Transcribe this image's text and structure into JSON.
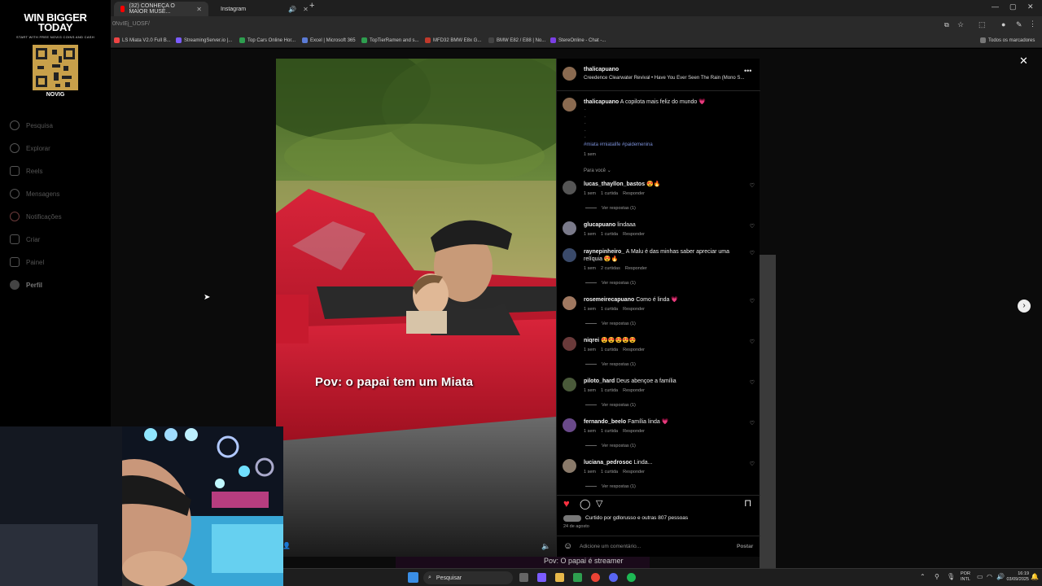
{
  "overlay": {
    "promo_title_line1": "WIN BIGGER",
    "promo_title_line2": "TODAY",
    "promo_subtitle": "START WITH FREE NOVIG COINS AND CASH",
    "promo_brand": "NOVIG"
  },
  "sidebar": {
    "items": [
      {
        "label": "Pesquisa",
        "icon": "search-icon"
      },
      {
        "label": "Explorar",
        "icon": "compass-icon"
      },
      {
        "label": "Reels",
        "icon": "reels-icon"
      },
      {
        "label": "Mensagens",
        "icon": "messenger-icon"
      },
      {
        "label": "Notificações",
        "icon": "heart-icon"
      },
      {
        "label": "Criar",
        "icon": "plus-icon"
      },
      {
        "label": "Painel",
        "icon": "dashboard-icon"
      },
      {
        "label": "Perfil",
        "icon": "profile-avatar-icon"
      }
    ]
  },
  "browser": {
    "tabs": [
      {
        "label": "(32) CONHEÇA O MAIOR MUSE...",
        "icon": "youtube-icon",
        "color": "#ff0000"
      },
      {
        "label": "Instagram",
        "icon": "instagram-icon",
        "color": "#e1306c"
      }
    ],
    "url": "0NvIEj_UOSF/",
    "bookmarks": [
      {
        "label": "LS Miata V2.0 Full B...",
        "color": "#e44"
      },
      {
        "label": "StreamingServer.io |...",
        "color": "#7b5cff"
      },
      {
        "label": "Top Cars Online Hor...",
        "color": "#2e9e4f"
      },
      {
        "label": "Excel | Microsoft 365",
        "color": "#5b7bd5"
      },
      {
        "label": "TopTierRamen and s...",
        "color": "#2e9e4f"
      },
      {
        "label": "MFD32 BMW E8x G...",
        "color": "#c0392b"
      },
      {
        "label": "BMW E82 / E88 | No...",
        "color": "#333"
      },
      {
        "label": "StereOnline - Chat -...",
        "color": "#7b3fe4"
      }
    ],
    "bookmarks_all": "Todos os marcadores"
  },
  "video": {
    "caption": "Pov: o papai tem um Miata"
  },
  "post": {
    "author": "thalicapuano",
    "audio": "Creedence Clearwater Revival • Have You Ever Seen The Rain (Mono S...",
    "caption_text": "A copilota mais feliz do mundo 💗",
    "dots": [
      ".",
      ".",
      ".",
      ".",
      "."
    ],
    "hashtags": "#miata #miatalife #paidemenina",
    "caption_time": "1 sem",
    "for_you": "Para você",
    "comments": [
      {
        "user": "lucas_thayllon_bastos",
        "text": "😍🔥",
        "time": "1 sem",
        "likes": "1 curtida",
        "reply": "Responder",
        "view": "Ver respostas (1)"
      },
      {
        "user": "glucapuano",
        "text": "lindaaa",
        "time": "1 sem",
        "likes": "1 curtida",
        "reply": "Responder",
        "view": ""
      },
      {
        "user": "raynepinheiro_",
        "text": "A Malu é das minhas saber apreciar uma relíquia 😍🔥",
        "time": "1 sem",
        "likes": "2 curtidas",
        "reply": "Responder",
        "view": "Ver respostas (1)"
      },
      {
        "user": "rosemeirecapuano",
        "text": "Como é linda 💗",
        "time": "1 sem",
        "likes": "1 curtida",
        "reply": "Responder",
        "view": "Ver respostas (1)"
      },
      {
        "user": "niqrei",
        "text": "😍😍😍😍😍",
        "time": "1 sem",
        "likes": "1 curtida",
        "reply": "Responder",
        "view": "Ver respostas (1)"
      },
      {
        "user": "piloto_hard",
        "text": "Deus abençoe a família",
        "time": "1 sem",
        "likes": "1 curtida",
        "reply": "Responder",
        "view": "Ver respostas (1)"
      },
      {
        "user": "fernando_beelo",
        "text": "Família linda 💗",
        "time": "1 sem",
        "likes": "1 curtida",
        "reply": "Responder",
        "view": "Ver respostas (1)"
      },
      {
        "user": "luciana_pedrosoc",
        "text": "Linda...",
        "time": "1 sem",
        "likes": "1 curtida",
        "reply": "Responder",
        "view": "Ver respostas (1)"
      }
    ],
    "liked_by": "Curtido por gdlorusso e outras 807 pessoas",
    "date": "24 de agosto",
    "comment_placeholder": "Adicione um comentário...",
    "post_button": "Postar"
  },
  "stream_subtitle": "Pov: O papai é streamer",
  "taskbar": {
    "search_label": "Pesquisar",
    "lang_line1": "POR",
    "lang_line2": "INTL",
    "time": "16:19",
    "date": "03/09/2025"
  }
}
